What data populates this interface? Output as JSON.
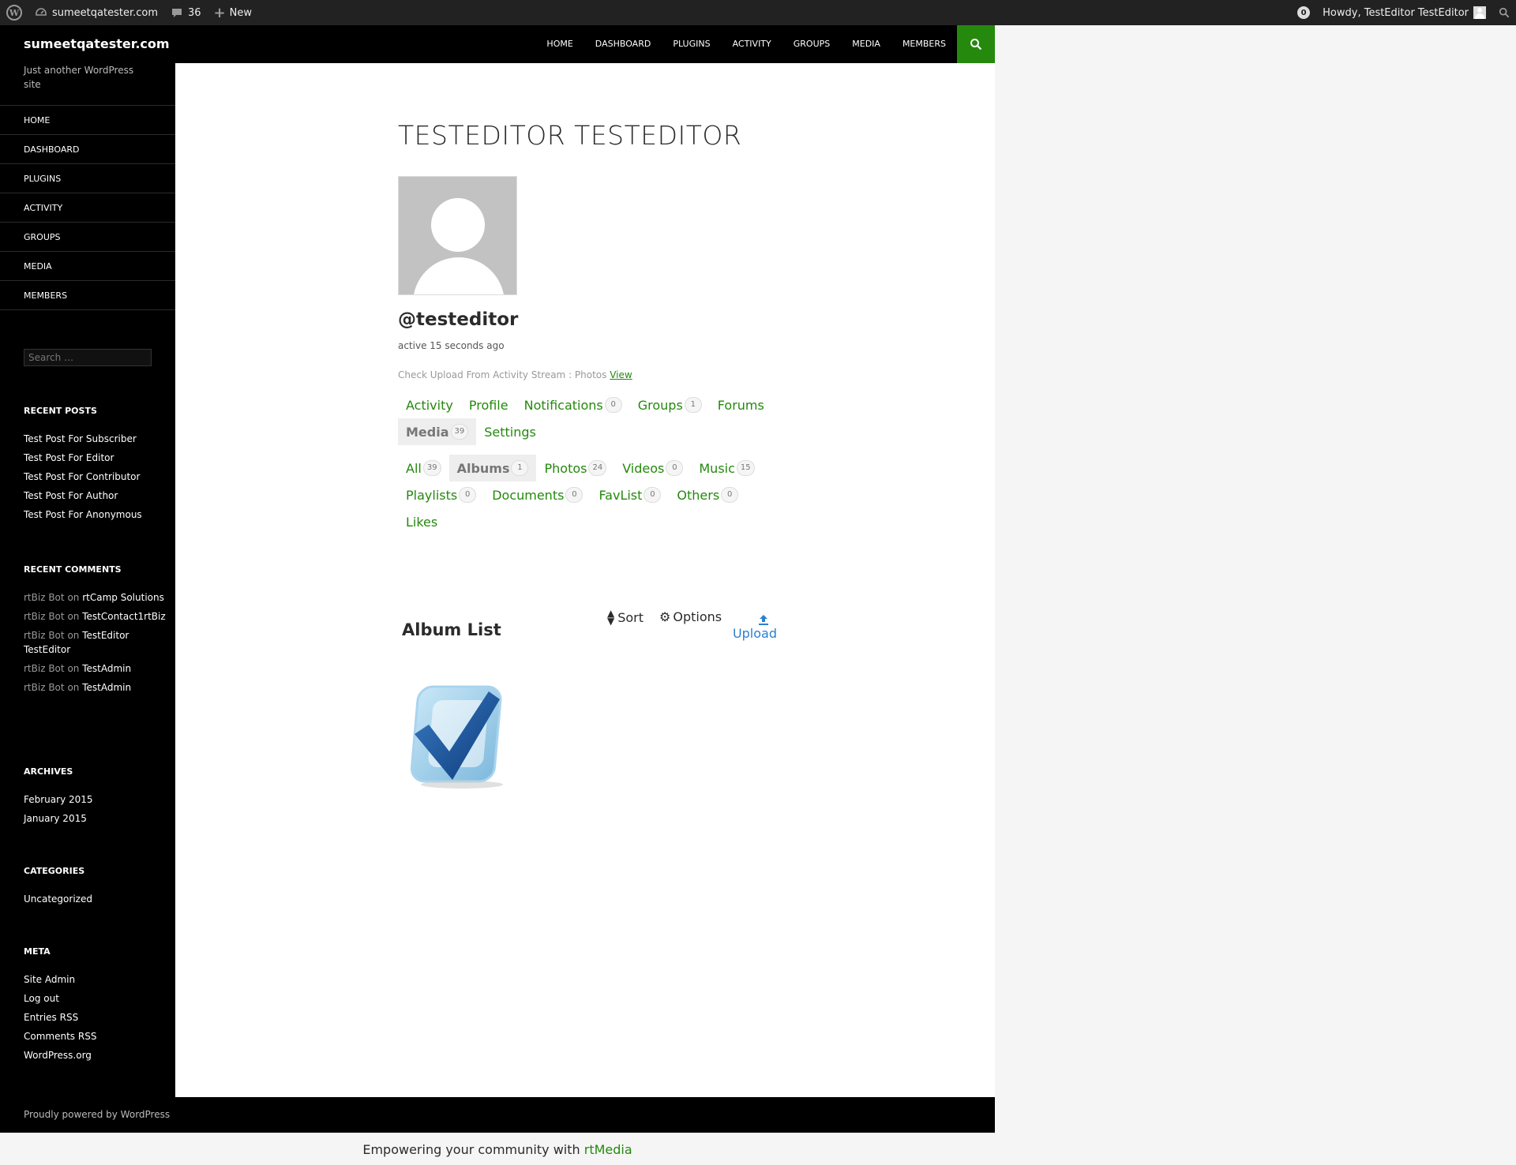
{
  "admin_bar": {
    "site": "sumeetqatester.com",
    "comments_count": "36",
    "new_label": "New",
    "notifications_count": "0",
    "howdy": "Howdy, TestEditor TestEditor"
  },
  "header": {
    "site_title": "sumeetqatester.com",
    "nav": [
      "HOME",
      "DASHBOARD",
      "PLUGINS",
      "ACTIVITY",
      "GROUPS",
      "MEDIA",
      "MEMBERS"
    ]
  },
  "sidebar": {
    "description": "Just another WordPress site",
    "nav": [
      "HOME",
      "DASHBOARD",
      "PLUGINS",
      "ACTIVITY",
      "GROUPS",
      "MEDIA",
      "MEMBERS"
    ],
    "search_placeholder": "Search …",
    "recent_posts": {
      "title": "RECENT POSTS",
      "items": [
        "Test Post For Subscriber",
        "Test Post For Editor",
        "Test Post For Contributor",
        "Test Post For Author",
        "Test Post For Anonymous"
      ]
    },
    "recent_comments": {
      "title": "RECENT COMMENTS",
      "items": [
        {
          "author": "rtBiz Bot",
          "on": "on",
          "target": "rtCamp Solutions"
        },
        {
          "author": "rtBiz Bot",
          "on": "on",
          "target": "TestContact1rtBiz"
        },
        {
          "author": "rtBiz Bot",
          "on": "on",
          "target": "TestEditor TestEditor"
        },
        {
          "author": "rtBiz Bot",
          "on": "on",
          "target": "TestAdmin"
        },
        {
          "author": "rtBiz Bot",
          "on": "on",
          "target": "TestAdmin"
        }
      ]
    },
    "archives": {
      "title": "ARCHIVES",
      "items": [
        "February 2015",
        "January 2015"
      ]
    },
    "categories": {
      "title": "CATEGORIES",
      "items": [
        "Uncategorized"
      ]
    },
    "meta": {
      "title": "META",
      "items": [
        "Site Admin",
        "Log out",
        "Entries RSS",
        "Comments RSS",
        "WordPress.org"
      ]
    }
  },
  "profile": {
    "title": "TESTEDITOR TESTEDITOR",
    "username": "@testeditor",
    "active": "active 15 seconds ago",
    "activity_text": "Check Upload From Activity Stream : Photos",
    "activity_link": "View"
  },
  "main_tabs": [
    {
      "label": "Activity",
      "count": null
    },
    {
      "label": "Profile",
      "count": null
    },
    {
      "label": "Notifications",
      "count": "0"
    },
    {
      "label": "Groups",
      "count": "1"
    },
    {
      "label": "Forums",
      "count": null
    },
    {
      "label": "Media",
      "count": "39",
      "active": true
    },
    {
      "label": "Settings",
      "count": null
    }
  ],
  "sub_tabs": [
    {
      "label": "All",
      "count": "39"
    },
    {
      "label": "Albums",
      "count": "1",
      "active": true
    },
    {
      "label": "Photos",
      "count": "24"
    },
    {
      "label": "Videos",
      "count": "0"
    },
    {
      "label": "Music",
      "count": "15"
    },
    {
      "label": "Playlists",
      "count": "0"
    },
    {
      "label": "Documents",
      "count": "0"
    },
    {
      "label": "FavList",
      "count": "0"
    },
    {
      "label": "Others",
      "count": "0"
    },
    {
      "label": "Likes",
      "count": null
    }
  ],
  "media": {
    "header": "Album List",
    "sort": "Sort",
    "options": "Options",
    "upload": "Upload"
  },
  "footer": {
    "powered": "Proudly powered by WordPress",
    "rtmedia_text": "Empowering your community with",
    "rtmedia_link": "rtMedia"
  },
  "colors": {
    "accent": "#24890d",
    "upload_blue": "#2b7fd1"
  }
}
